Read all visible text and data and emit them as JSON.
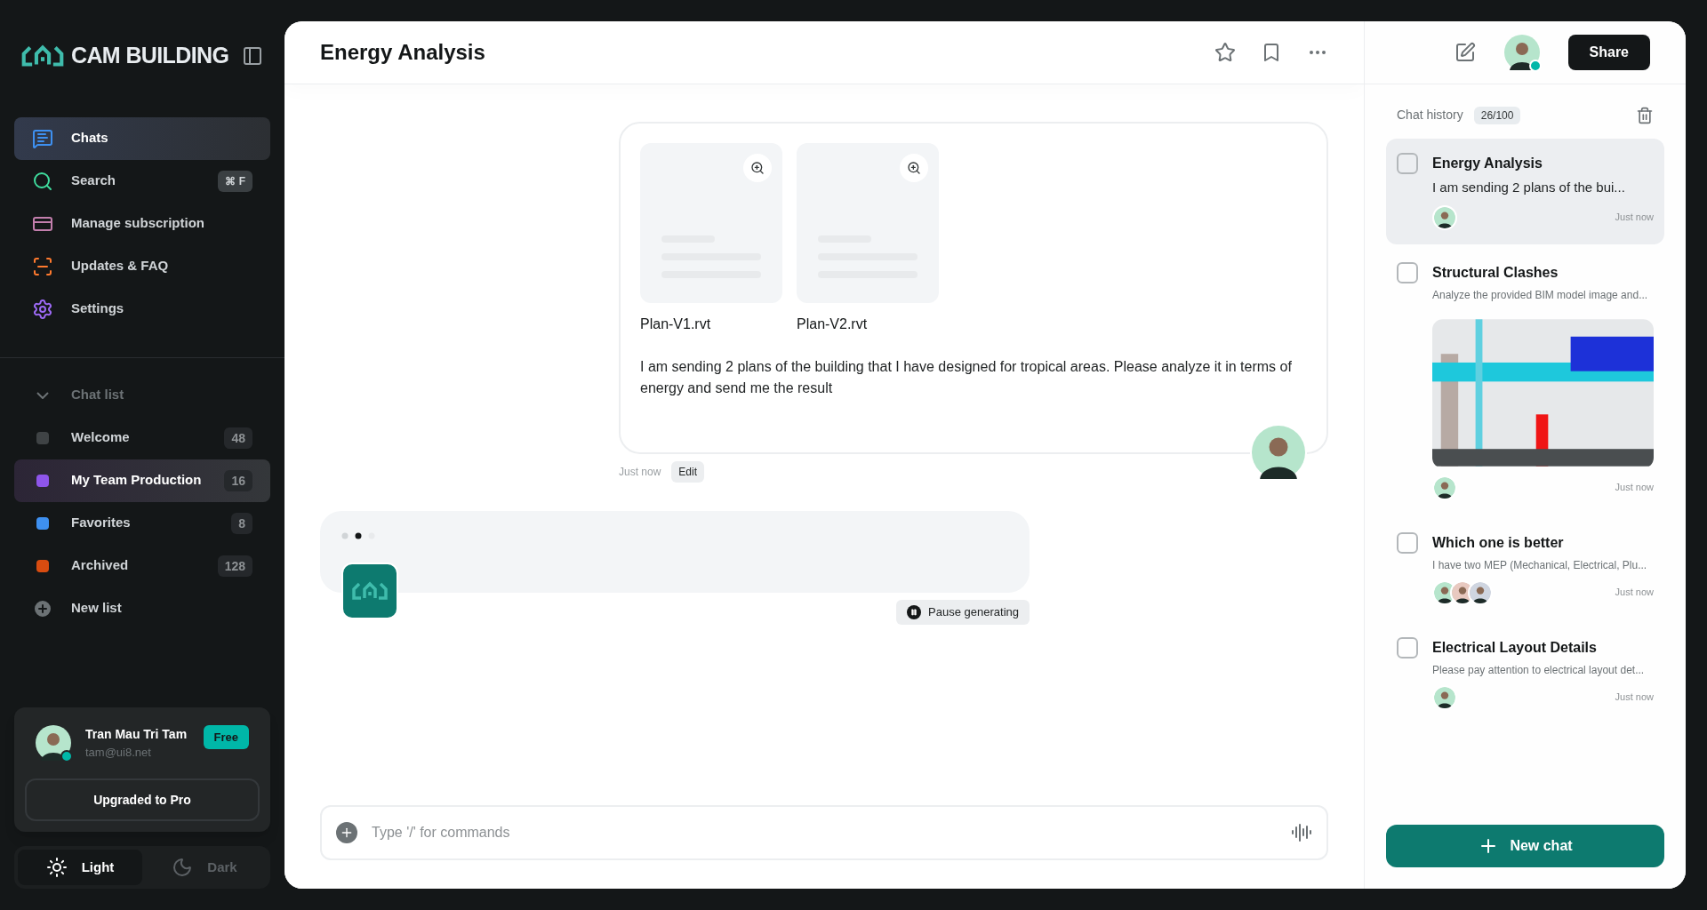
{
  "sidebar": {
    "brand": "CAM BUILDING",
    "nav": [
      {
        "label": "Chats",
        "kind": "chat",
        "selected": true
      },
      {
        "label": "Search",
        "kind": "search",
        "selected": false,
        "shortcut": "⌘ F"
      },
      {
        "label": "Manage subscription",
        "kind": "card",
        "selected": false
      },
      {
        "label": "Updates & FAQ",
        "kind": "scan",
        "selected": false
      },
      {
        "label": "Settings",
        "kind": "gear",
        "selected": false
      }
    ],
    "chat_list": {
      "title": "Chat list",
      "expanded": true,
      "lists": [
        {
          "name": "Welcome",
          "count": "48",
          "color": "#3f4345",
          "selected": false
        },
        {
          "name": "My Team Production",
          "count": "16",
          "color": "#8e55ea",
          "selected": true
        },
        {
          "name": "Favorites",
          "count": "8",
          "color": "#3e90f0",
          "selected": false
        },
        {
          "name": "Archived",
          "count": "128",
          "color": "#d84c10",
          "selected": false
        }
      ],
      "new_list": "New list"
    },
    "user": {
      "name": "Tran Mau Tri Tam",
      "email": "tam@ui8.net",
      "plan": "Free",
      "online": true
    },
    "upgrade_button": "Upgraded to Pro",
    "theme": [
      {
        "label": "Light",
        "kind": "sun",
        "selected": true
      },
      {
        "label": "Dark",
        "kind": "moon",
        "selected": false
      }
    ]
  },
  "header": {
    "title": "Energy Analysis"
  },
  "message": {
    "files": [
      {
        "name": "Plan-V1.rvt"
      },
      {
        "name": "Plan-V2.rvt"
      }
    ],
    "text": "I am sending 2 plans of the building that I have designed for tropical areas. Please analyze it in terms of energy and send me the result",
    "time": "Just now",
    "edit": "Edit"
  },
  "reply": {
    "pause": "Pause generating"
  },
  "composer": {
    "placeholder": "Type '/' for commands"
  },
  "right": {
    "share": "Share",
    "user_online": true,
    "history": {
      "title": "Chat history",
      "count": "26/100",
      "items": [
        {
          "title": "Energy Analysis",
          "preview": "I am sending 2 plans of the bui...",
          "checked": false,
          "selected": true,
          "avatars": [
            {
              "color": "#b6e5cc"
            }
          ],
          "time": "Just now"
        },
        {
          "title": "Structural Clashes",
          "preview": "Analyze the provided BIM model image and...",
          "checked": false,
          "selected": false,
          "image": true,
          "avatars": [
            {
              "color": "#b6e5cc"
            }
          ],
          "time": "Just now"
        },
        {
          "title": "Which one is better",
          "preview": "I have two MEP (Mechanical, Electrical, Plu...",
          "checked": false,
          "selected": false,
          "avatars": [
            {
              "color": "#b6e5cc"
            },
            {
              "color": "#e8c9c0"
            },
            {
              "color": "#cfd5e0"
            }
          ],
          "time": "Just now"
        },
        {
          "title": "Electrical Layout Details",
          "preview": "Please pay attention to electrical layout det...",
          "checked": false,
          "selected": false,
          "avatars": [
            {
              "color": "#b6e5cc"
            }
          ],
          "time": "Just now"
        }
      ]
    },
    "new_chat": "New chat"
  }
}
